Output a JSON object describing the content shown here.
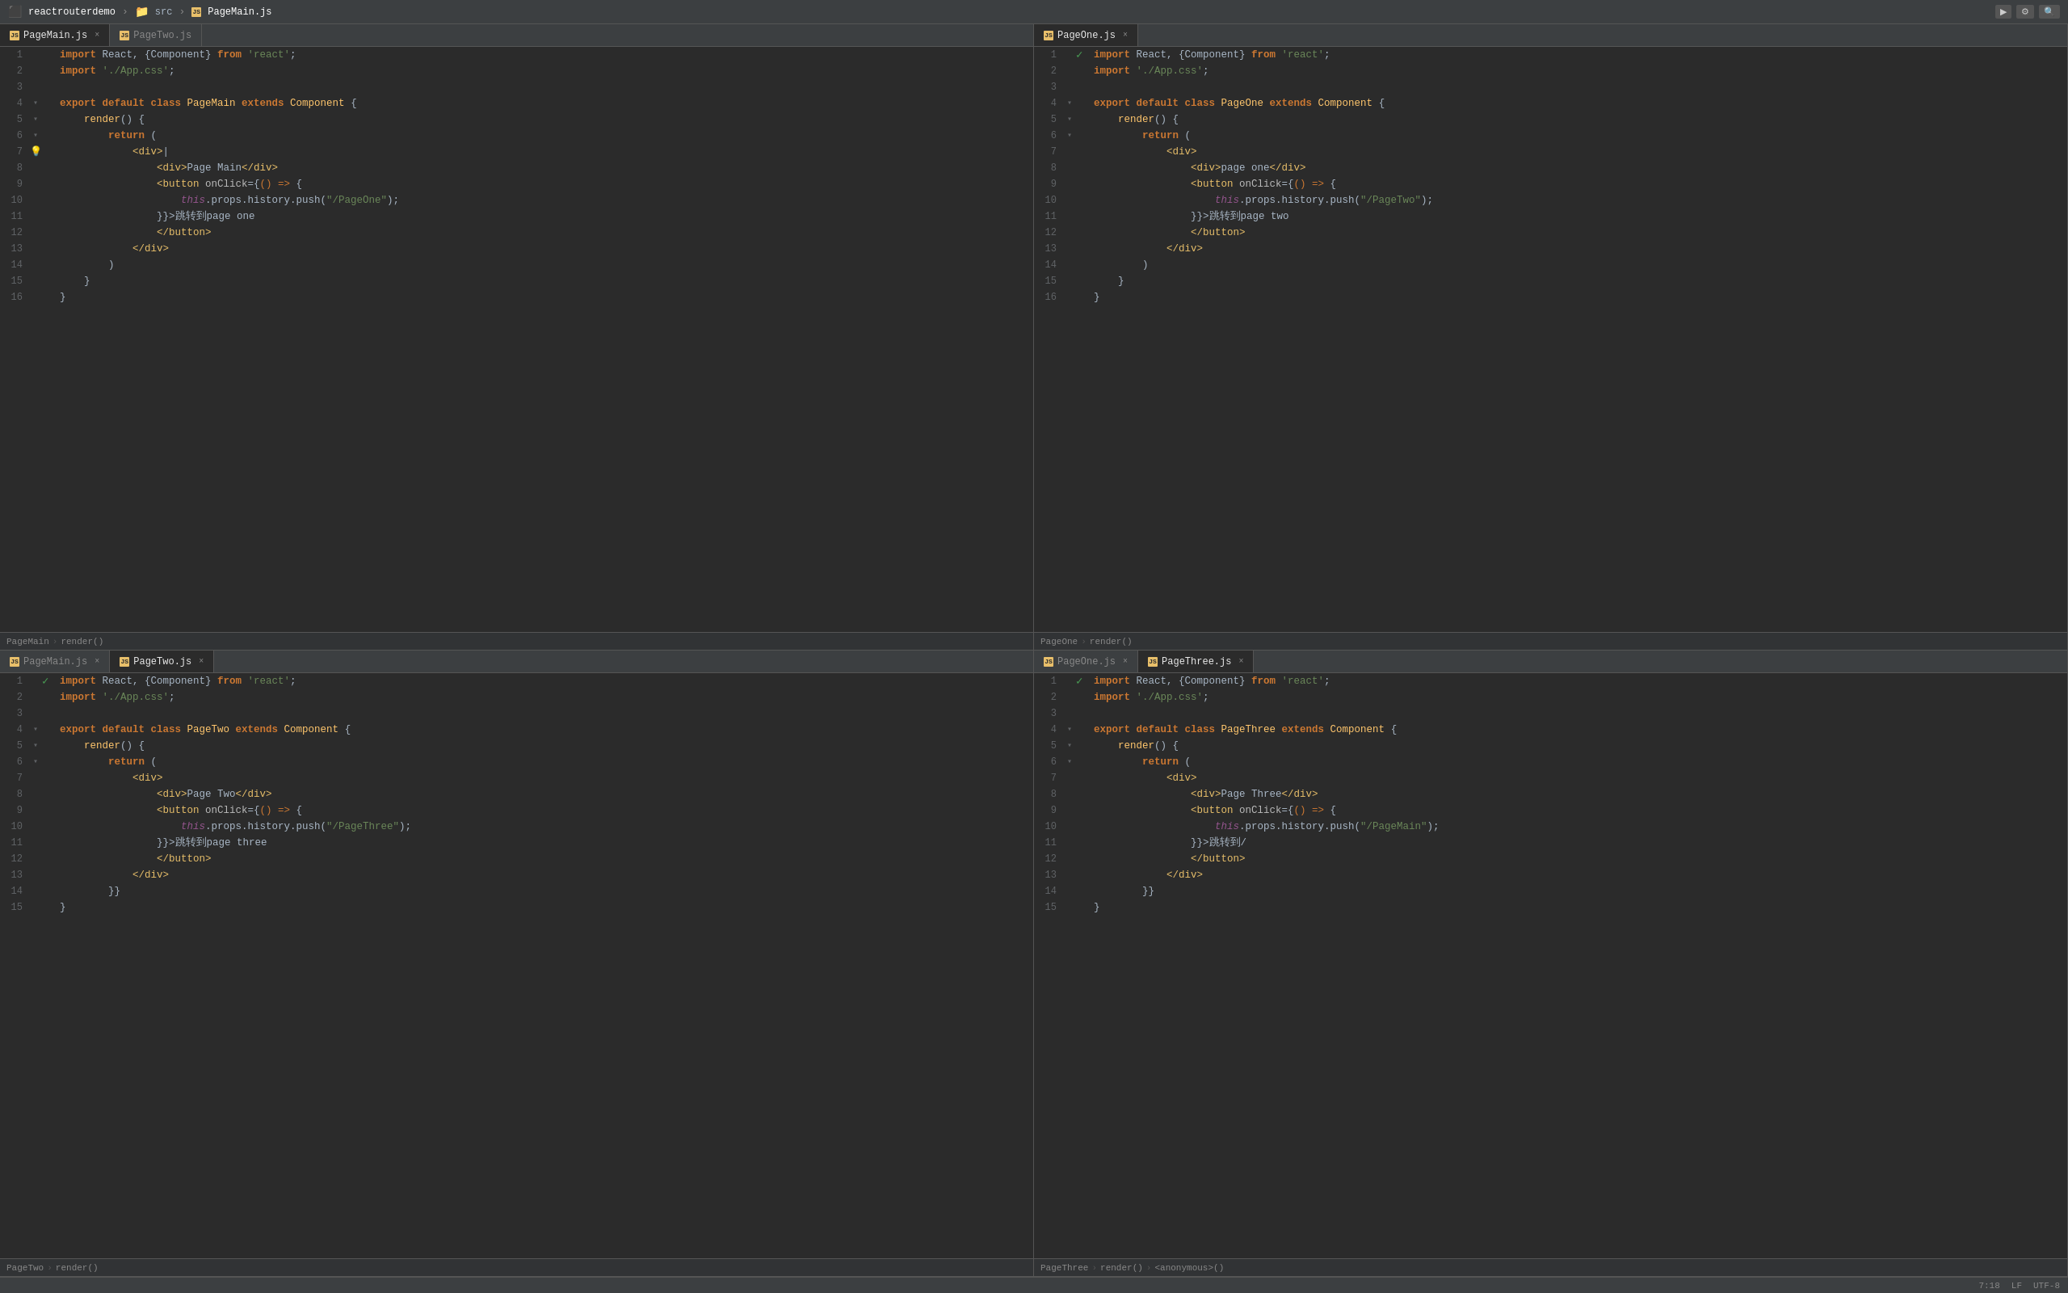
{
  "titleBar": {
    "projectIcon": "🔲",
    "projectName": "reactrouterdemo",
    "folderIcon": "📁",
    "folderName": "src",
    "fileIcon": "📄",
    "fileName": "PageMain.js"
  },
  "statusBar": {
    "line": "7:18",
    "lineEnding": "LF",
    "encoding": "UTF-8",
    "suffix": "8"
  },
  "panes": [
    {
      "id": "top-left",
      "tabs": [
        {
          "label": "PageMain.js",
          "active": true,
          "closable": true
        },
        {
          "label": "PageTwo.js",
          "active": false,
          "closable": false
        }
      ],
      "breadcrumb": [
        "PageMain",
        "render()"
      ],
      "lines": [
        {
          "num": 1,
          "gutter": "",
          "content": "<kw>import</kw> React, {Component} <kw>from</kw> <str>'react'</str>;",
          "indicator": ""
        },
        {
          "num": 2,
          "gutter": "",
          "content": "<kw>import</kw> <str>'./App.css'</str>;",
          "indicator": ""
        },
        {
          "num": 3,
          "gutter": "",
          "content": "",
          "indicator": ""
        },
        {
          "num": 4,
          "gutter": "fold",
          "content": "<kw>export default class</kw> <cls>PageMain</cls> <kw>extends</kw> <cls>Component</cls> {",
          "indicator": ""
        },
        {
          "num": 5,
          "gutter": "fold",
          "content": "    <fn>render</fn>() {",
          "indicator": ""
        },
        {
          "num": 6,
          "gutter": "fold",
          "content": "        <kw>return</kw> (",
          "indicator": ""
        },
        {
          "num": 7,
          "gutter": "bulb",
          "content": "            <jsx-tag>&lt;div&gt;</jsx-tag>|",
          "indicator": ""
        },
        {
          "num": 8,
          "gutter": "",
          "content": "                <jsx-tag>&lt;div&gt;</jsx-tag>Page Main<jsx-tag>&lt;/div&gt;</jsx-tag>",
          "indicator": ""
        },
        {
          "num": 9,
          "gutter": "",
          "content": "                <jsx-tag>&lt;button</jsx-tag> <atr>onClick</atr>={<arrow>() =&gt;</arrow> {",
          "indicator": ""
        },
        {
          "num": 10,
          "gutter": "",
          "content": "                    <this-kw>this</this-kw>.props.history.push(<str>\"/PageOne\"</str>);",
          "indicator": ""
        },
        {
          "num": 11,
          "gutter": "",
          "content": "                }}&gt;<chinese>跳转到</chinese>page one",
          "indicator": ""
        },
        {
          "num": 12,
          "gutter": "",
          "content": "                <jsx-tag>&lt;/button&gt;</jsx-tag>",
          "indicator": ""
        },
        {
          "num": 13,
          "gutter": "",
          "content": "            <jsx-tag>&lt;/div&gt;</jsx-tag>",
          "indicator": ""
        },
        {
          "num": 14,
          "gutter": "",
          "content": "        )",
          "indicator": ""
        },
        {
          "num": 15,
          "gutter": "",
          "content": "    }",
          "indicator": ""
        },
        {
          "num": 16,
          "gutter": "",
          "content": "}",
          "indicator": ""
        }
      ]
    },
    {
      "id": "top-right",
      "tabs": [
        {
          "label": "PageOne.js",
          "active": true,
          "closable": true
        }
      ],
      "breadcrumb": [
        "PageOne",
        "render()"
      ],
      "lines": [
        {
          "num": 1,
          "gutter": "",
          "content": "<kw>import</kw> React, {Component} <kw>from</kw> <str>'react'</str>;",
          "indicator": "green"
        },
        {
          "num": 2,
          "gutter": "",
          "content": "<kw>import</kw> <str>'./App.css'</str>;",
          "indicator": ""
        },
        {
          "num": 3,
          "gutter": "",
          "content": "",
          "indicator": ""
        },
        {
          "num": 4,
          "gutter": "fold",
          "content": "<kw>export default class</kw> <cls>PageOne</cls> <kw>extends</kw> <cls>Component</cls> {",
          "indicator": ""
        },
        {
          "num": 5,
          "gutter": "fold",
          "content": "    <fn>render</fn>() {",
          "indicator": ""
        },
        {
          "num": 6,
          "gutter": "fold",
          "content": "        <kw>return</kw> (",
          "indicator": ""
        },
        {
          "num": 7,
          "gutter": "",
          "content": "            <jsx-tag>&lt;div&gt;</jsx-tag>",
          "indicator": ""
        },
        {
          "num": 8,
          "gutter": "",
          "content": "                <jsx-tag>&lt;div&gt;</jsx-tag>page one<jsx-tag>&lt;/div&gt;</jsx-tag>",
          "indicator": ""
        },
        {
          "num": 9,
          "gutter": "",
          "content": "                <jsx-tag>&lt;button</jsx-tag> <atr>onClick</atr>={<arrow>() =&gt;</arrow> {",
          "indicator": ""
        },
        {
          "num": 10,
          "gutter": "",
          "content": "                    <this-kw>this</this-kw>.props.history.push(<str>\"/PageTwo\"</str>);",
          "indicator": ""
        },
        {
          "num": 11,
          "gutter": "",
          "content": "                }}&gt;<chinese>跳转到</chinese>page two",
          "indicator": ""
        },
        {
          "num": 12,
          "gutter": "",
          "content": "                <jsx-tag>&lt;/button&gt;</jsx-tag>",
          "indicator": ""
        },
        {
          "num": 13,
          "gutter": "",
          "content": "            <jsx-tag>&lt;/div&gt;</jsx-tag>",
          "indicator": ""
        },
        {
          "num": 14,
          "gutter": "",
          "content": "        )",
          "indicator": ""
        },
        {
          "num": 15,
          "gutter": "",
          "content": "    }",
          "indicator": ""
        },
        {
          "num": 16,
          "gutter": "",
          "content": "}",
          "indicator": ""
        }
      ]
    },
    {
      "id": "bottom-left",
      "tabs": [
        {
          "label": "PageMain.js",
          "active": false,
          "closable": true
        },
        {
          "label": "PageTwo.js",
          "active": true,
          "closable": true
        }
      ],
      "breadcrumb": [
        "PageTwo",
        "render()"
      ],
      "lines": [
        {
          "num": 1,
          "gutter": "",
          "content": "<kw>import</kw> React, {Component} <kw>from</kw> <str>'react'</str>;",
          "indicator": "green"
        },
        {
          "num": 2,
          "gutter": "",
          "content": "<kw>import</kw> <str>'./App.css'</str>;",
          "indicator": ""
        },
        {
          "num": 3,
          "gutter": "",
          "content": "",
          "indicator": ""
        },
        {
          "num": 4,
          "gutter": "fold",
          "content": "<kw>export default class</kw> <cls>PageTwo</cls> <kw>extends</kw> <cls>Component</cls> {",
          "indicator": ""
        },
        {
          "num": 5,
          "gutter": "fold",
          "content": "    <fn>render</fn>() {",
          "indicator": ""
        },
        {
          "num": 6,
          "gutter": "fold",
          "content": "        <kw>return</kw> (",
          "indicator": ""
        },
        {
          "num": 7,
          "gutter": "",
          "content": "            <jsx-tag>&lt;div&gt;</jsx-tag>",
          "indicator": ""
        },
        {
          "num": 8,
          "gutter": "",
          "content": "                <jsx-tag>&lt;div&gt;</jsx-tag>Page Two<jsx-tag>&lt;/div&gt;</jsx-tag>",
          "indicator": ""
        },
        {
          "num": 9,
          "gutter": "",
          "content": "                <jsx-tag>&lt;button</jsx-tag> <atr>onClick</atr>={<arrow>() =&gt;</arrow> {",
          "indicator": ""
        },
        {
          "num": 10,
          "gutter": "",
          "content": "                    <this-kw>this</this-kw>.props.history.push(<str>\"/PageThree\"</str>);",
          "indicator": ""
        },
        {
          "num": 11,
          "gutter": "",
          "content": "                }}&gt;<chinese>跳转到</chinese>page three",
          "indicator": ""
        },
        {
          "num": 12,
          "gutter": "",
          "content": "                <jsx-tag>&lt;/button&gt;</jsx-tag>",
          "indicator": ""
        },
        {
          "num": 13,
          "gutter": "",
          "content": "            <jsx-tag>&lt;/div&gt;</jsx-tag>",
          "indicator": ""
        },
        {
          "num": 14,
          "gutter": "",
          "content": "        }}",
          "indicator": ""
        },
        {
          "num": 15,
          "gutter": "",
          "content": "}",
          "indicator": ""
        }
      ]
    },
    {
      "id": "bottom-right",
      "tabs": [
        {
          "label": "PageOne.js",
          "active": false,
          "closable": true
        },
        {
          "label": "PageThree.js",
          "active": true,
          "closable": true
        }
      ],
      "breadcrumb": [
        "PageThree",
        "render()",
        "<anonymous>()"
      ],
      "lines": [
        {
          "num": 1,
          "gutter": "",
          "content": "<kw>import</kw> React, {Component} <kw>from</kw> <str>'react'</str>;",
          "indicator": "green"
        },
        {
          "num": 2,
          "gutter": "",
          "content": "<kw>import</kw> <str>'./App.css'</str>;",
          "indicator": ""
        },
        {
          "num": 3,
          "gutter": "",
          "content": "",
          "indicator": ""
        },
        {
          "num": 4,
          "gutter": "fold",
          "content": "<kw>export default class</kw> <cls>PageThree</cls> <kw>extends</kw> <cls>Component</cls> {",
          "indicator": ""
        },
        {
          "num": 5,
          "gutter": "fold",
          "content": "    <fn>render</fn>() {",
          "indicator": ""
        },
        {
          "num": 6,
          "gutter": "fold",
          "content": "        <kw>return</kw> (",
          "indicator": ""
        },
        {
          "num": 7,
          "gutter": "",
          "content": "            <jsx-tag>&lt;div&gt;</jsx-tag>",
          "indicator": ""
        },
        {
          "num": 8,
          "gutter": "",
          "content": "                <jsx-tag>&lt;div&gt;</jsx-tag>Page Three<jsx-tag>&lt;/div&gt;</jsx-tag>",
          "indicator": ""
        },
        {
          "num": 9,
          "gutter": "",
          "content": "                <jsx-tag>&lt;button</jsx-tag> <atr>onClick</atr>={<arrow>() =&gt;</arrow> {",
          "indicator": ""
        },
        {
          "num": 10,
          "gutter": "",
          "content": "                    <this-kw>this</this-kw>.props.history.push(<str>\"/PageMain\"</str>);",
          "indicator": ""
        },
        {
          "num": 11,
          "gutter": "",
          "content": "                }}&gt;<chinese>跳转到</chinese>/",
          "indicator": ""
        },
        {
          "num": 12,
          "gutter": "",
          "content": "                <jsx-tag>&lt;/button&gt;</jsx-tag>",
          "indicator": ""
        },
        {
          "num": 13,
          "gutter": "",
          "content": "            <jsx-tag>&lt;/div&gt;</jsx-tag>",
          "indicator": ""
        },
        {
          "num": 14,
          "gutter": "",
          "content": "        }}",
          "indicator": ""
        },
        {
          "num": 15,
          "gutter": "",
          "content": "}",
          "indicator": ""
        }
      ]
    }
  ]
}
